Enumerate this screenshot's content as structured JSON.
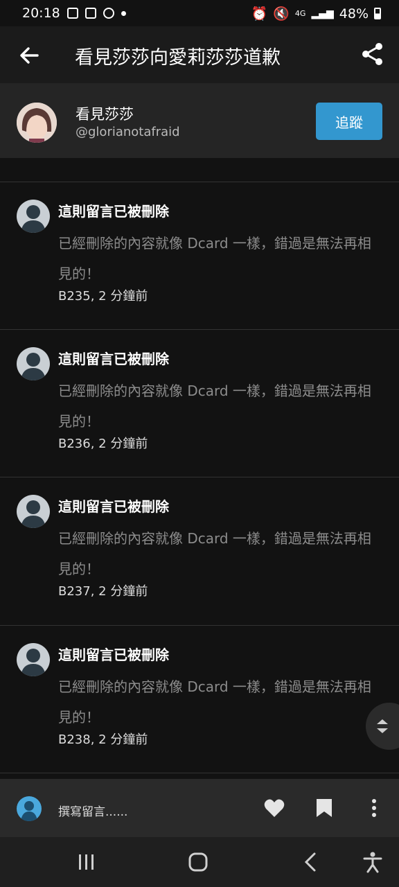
{
  "status": {
    "time": "20:18",
    "network": "4G",
    "battery": "48%"
  },
  "appbar": {
    "title": "看見莎莎向愛莉莎莎道歉"
  },
  "author": {
    "name": "看見莎莎",
    "handle": "@glorianotafraid",
    "follow_label": "追蹤"
  },
  "comments": [
    {
      "heading": "這則留言已被刪除",
      "body": "已經刪除的內容就像 Dcard 一樣，錯過是無法再相見的！",
      "meta": "B235, 2 分鐘前"
    },
    {
      "heading": "這則留言已被刪除",
      "body": "已經刪除的內容就像 Dcard 一樣，錯過是無法再相見的！",
      "meta": "B236, 2 分鐘前"
    },
    {
      "heading": "這則留言已被刪除",
      "body": "已經刪除的內容就像 Dcard 一樣，錯過是無法再相見的！",
      "meta": "B237, 2 分鐘前"
    },
    {
      "heading": "這則留言已被刪除",
      "body": "已經刪除的內容就像 Dcard 一樣，錯過是無法再相見的！",
      "meta": "B238, 2 分鐘前"
    }
  ],
  "composer": {
    "placeholder": "撰寫留言......"
  },
  "icons": {
    "back": "arrow-left-icon",
    "share": "share-icon",
    "like": "heart-icon",
    "bookmark": "bookmark-icon",
    "more": "more-vertical-icon",
    "scroll": "scroll-up-down-icon"
  },
  "colors": {
    "accent": "#3397cf",
    "background": "#121212",
    "muted_text": "#8c8c8c"
  }
}
